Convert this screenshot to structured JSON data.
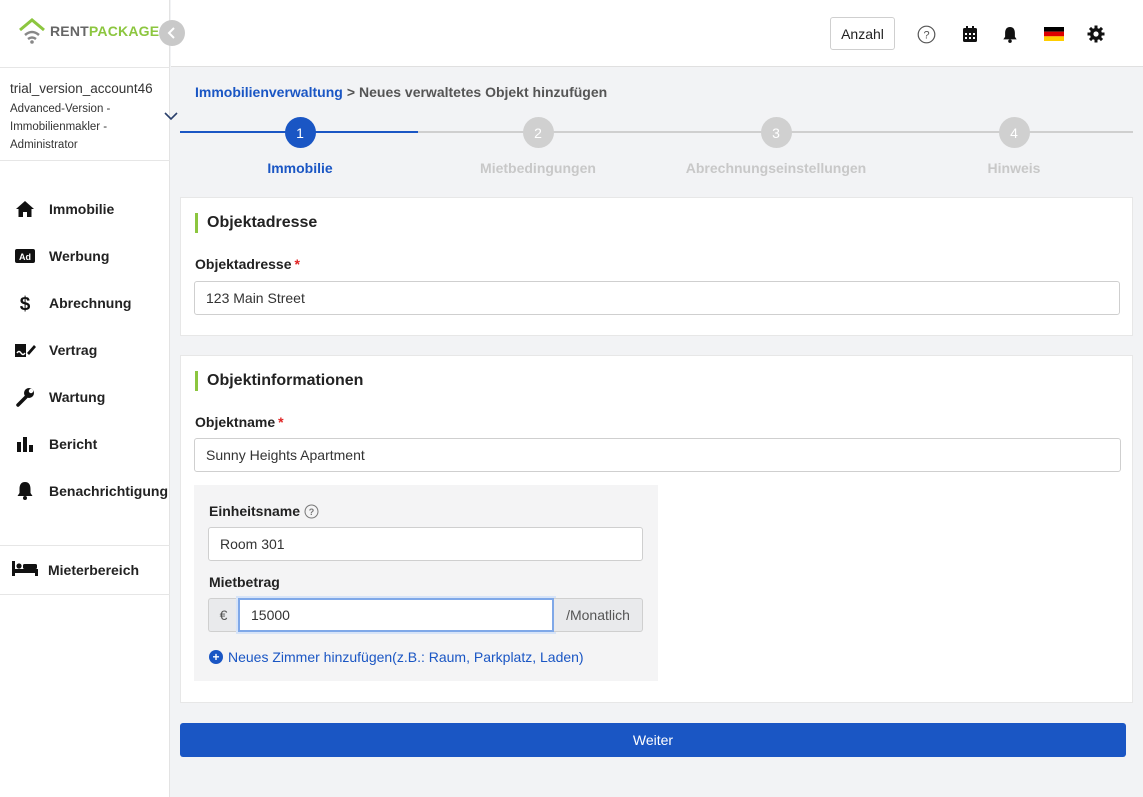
{
  "app": {
    "logo_rent": "RENT",
    "logo_package": "PACKAGE"
  },
  "account": {
    "name": "trial_version_account46",
    "role": "Advanced-Version - Immobilienmakler - Administrator"
  },
  "sidebar": {
    "items": [
      {
        "label": "Immobilie",
        "icon": "home-icon"
      },
      {
        "label": "Werbung",
        "icon": "ad-icon"
      },
      {
        "label": "Abrechnung",
        "icon": "dollar-icon"
      },
      {
        "label": "Vertrag",
        "icon": "contract-icon"
      },
      {
        "label": "Wartung",
        "icon": "wrench-icon"
      },
      {
        "label": "Bericht",
        "icon": "bar-chart-icon"
      },
      {
        "label": "Benachrichtigung",
        "icon": "bell-icon"
      }
    ],
    "tenant_area": {
      "label": "Mieterbereich",
      "icon": "bed-icon"
    }
  },
  "topbar": {
    "count_button": "Anzahl",
    "icons": [
      "help-icon",
      "calendar-icon",
      "bell-icon",
      "german-flag-icon",
      "gear-icon"
    ]
  },
  "breadcrumb": {
    "link": "Immobilienverwaltung",
    "separator": ">",
    "current": "Neues verwaltetes Objekt hinzufügen"
  },
  "stepper": {
    "active_step": 1,
    "steps": [
      {
        "number": "1",
        "label": "Immobilie"
      },
      {
        "number": "2",
        "label": "Mietbedingungen"
      },
      {
        "number": "3",
        "label": "Abrechnungseinstellungen"
      },
      {
        "number": "4",
        "label": "Hinweis"
      }
    ]
  },
  "address_card": {
    "title": "Objektadresse",
    "field_label": "Objektadresse",
    "required_mark": "*",
    "value": "123 Main Street"
  },
  "info_card": {
    "title": "Objektinformationen",
    "name_label": "Objektname",
    "required_mark": "*",
    "name_value": "Sunny Heights Apartment",
    "unit": {
      "name_label": "Einheitsname",
      "name_value": "Room 301",
      "rent_label": "Mietbetrag",
      "currency": "€",
      "rent_value": "15000",
      "period": "/Monatlich",
      "add_room_link": "Neues Zimmer hinzufügen(z.B.: Raum, Parkplatz, Laden)"
    }
  },
  "next_button": "Weiter",
  "colors": {
    "primary": "#1a56c4",
    "accent_green": "#8cc63f",
    "required": "#e02424",
    "inactive_step": "#d0d0d0"
  }
}
